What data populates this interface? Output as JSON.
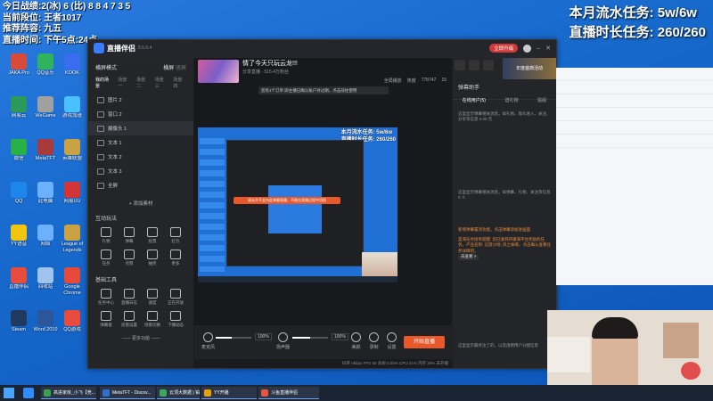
{
  "stream_overlay": {
    "left_lines": [
      "今日战绩:2(冰) 6 (比) 8 8 4 7 3 5",
      "当前段位: 王者1017",
      "推荐阵容: 九五",
      "直播时间: 下午5点:24点"
    ],
    "right_lines": [
      "本月流水任务: 5w/6w",
      "直播时长任务: 260/260"
    ]
  },
  "desktop_icons": [
    {
      "label": "JAKA Pro",
      "color": "#d84a3a"
    },
    {
      "label": "QQ音乐",
      "color": "#2fb35d"
    },
    {
      "label": "KOOK",
      "color": "#3a6cf0"
    },
    {
      "label": "网易云",
      "color": "#2a9a5a"
    },
    {
      "label": "WeGame",
      "color": "#a0a0a0"
    },
    {
      "label": "游戏加速",
      "color": "#4ac1ff"
    },
    {
      "label": "微信",
      "color": "#27b146"
    },
    {
      "label": "MetaTFT",
      "color": "#a83a3a"
    },
    {
      "label": "英雄联盟",
      "color": "#c9a244"
    },
    {
      "label": "QQ",
      "color": "#1e86ea"
    },
    {
      "label": "此电脑",
      "color": "#6bb1ff"
    },
    {
      "label": "网易UU",
      "color": "#d23535"
    },
    {
      "label": "YY语音",
      "color": "#f1c40f"
    },
    {
      "label": "网络",
      "color": "#6bb1ff"
    },
    {
      "label": "League of Legends",
      "color": "#c9a244"
    },
    {
      "label": "直播伴侣",
      "color": "#e74c3c"
    },
    {
      "label": "回收站",
      "color": "#9dc3ee"
    },
    {
      "label": "Google Chrome",
      "color": "#e84a3a"
    },
    {
      "label": "Steam",
      "color": "#1f3a5e"
    },
    {
      "label": "Word 2010",
      "color": "#2b579a"
    },
    {
      "label": "QQ游戏",
      "color": "#e74c3c"
    }
  ],
  "app": {
    "name": "直播伴侣",
    "version": "5.5.6.4",
    "upgrade_label": "立即升级",
    "top_actions": [
      "开播提醒",
      "分享"
    ],
    "left": {
      "mode_label": "横屏模式",
      "mode_buttons": [
        "横屏",
        "竖屏"
      ],
      "tabs": [
        "我的场景",
        "场景一",
        "场景二",
        "场景三",
        "场景四",
        "场景五"
      ],
      "scenes": [
        "图片 2",
        "窗口 2",
        "摄像头 1",
        "文本 1",
        "文本 2",
        "文本 3",
        "全屏"
      ],
      "add_label": "+ 添加素材",
      "interact_title": "互动玩法",
      "interact_items": [
        "礼物",
        "弹幕",
        "投票",
        "红包",
        "任务",
        "点赞",
        "抽奖",
        "更多"
      ],
      "basic_title": "基础工具",
      "basic_items": [
        "任务中心",
        "直播日志",
        "速度",
        "正在开放",
        "弹幕窗",
        "房管设置",
        "场景切换",
        "下播动态"
      ],
      "more_label": "—— 更多功能 ——"
    },
    "room": {
      "title": "情了今天只玩云龙!!!",
      "meta": "分享直播 · 515.4万粉丝",
      "stats": [
        "全局播放",
        "热度",
        "778747",
        "15"
      ],
      "notice": "您有1个订单 即主播已确认账户对过期，点击前往使用"
    },
    "preview": {
      "overlay_lines": [
        "本月流水任务: 5w/6w",
        "直播时长任务: 260/260"
      ],
      "tip": "请允许不支持此弹幕直播，不能在直播过程中切换"
    },
    "controls": {
      "mic_label": "麦克风",
      "mic_pct": "100%",
      "speaker_label": "扬声器",
      "speaker_pct": "100%",
      "mic_level": 0.45,
      "speaker_level": 0.5,
      "icons": [
        "美颜",
        "录制",
        "设置"
      ],
      "go_live": "开始直播"
    },
    "status": "码率 0kbps    FPS 60    丢帧 0.00%    CPU 21%    内存 28%    未开播",
    "right": {
      "banner": "年度盛典活动",
      "title": "弹幕助手",
      "tabs": [
        "在线用户(5)",
        "送礼物",
        "贴船"
      ],
      "msg1": "这里显示弹幕相关消息，如礼物、观众进入、关注、分享等信息 0.00 元",
      "msg2": "这里显示弹幕相关消息，如弹幕、礼物、关注等信息 0 人",
      "sys_lines": [
        "新增弹幕置顶功能，点击弹幕添加进画面",
        "是海任务接单提醒: 您已收到开播海平台奖励的任务，产品名称: 迅游沙场; 风之咏啊，点击确认查看任务详情吧。"
      ],
      "sys_btn": "去查看 >",
      "footer": "这里显示最终注了的，以及透明用户分配信息"
    }
  },
  "taskbar": {
    "apps": [
      {
        "label": "高进家房_小飞【竞...",
        "color": "#3aa34a"
      },
      {
        "label": "MetaTFT - Discov...",
        "color": "#2f6fd4"
      },
      {
        "label": "云顶大数据 | 铂金...",
        "color": "#3ba95c"
      },
      {
        "label": "YY开播",
        "color": "#e6a300"
      },
      {
        "label": "斗鱼直播伴侣",
        "color": "#e7563a"
      }
    ]
  }
}
